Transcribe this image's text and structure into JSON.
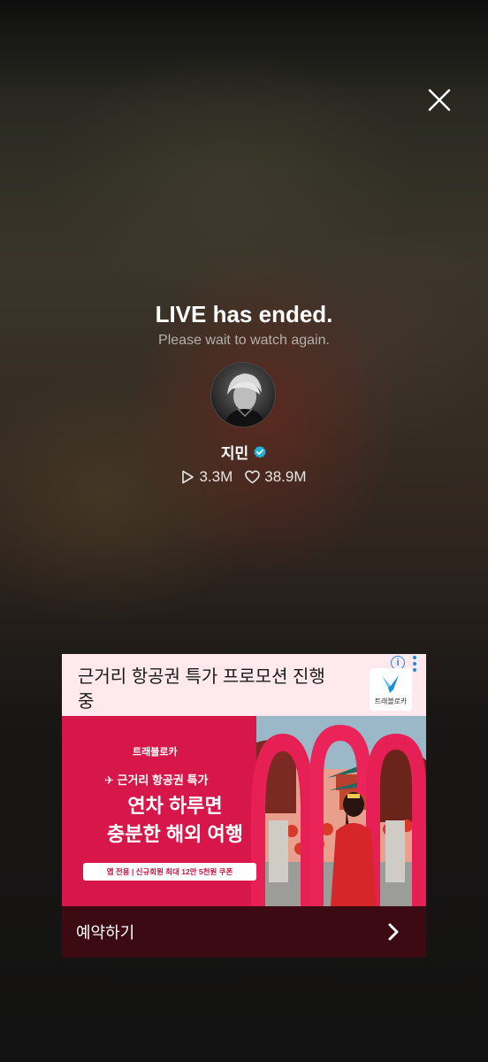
{
  "live": {
    "title": "LIVE has ended.",
    "subtitle": "Please wait to watch again."
  },
  "creator": {
    "name": "지민",
    "verified": true,
    "plays": "3.3M",
    "likes": "38.9M"
  },
  "ad": {
    "headline": "근거리 항공권 특가 프로모션 진행 중",
    "logo_text": "트래블로카",
    "info_icon": "i",
    "banner": {
      "brand": "트래블로카",
      "tag": "✈ 근거리 항공권 특가",
      "big_line1": "연차 하루면",
      "big_line2": "충분한 해외 여행",
      "coupon": "앱 전용 | 신규회원 최대 12만 5천원 쿠폰"
    },
    "cta_label": "예약하기"
  },
  "colors": {
    "accent_verified": "#20b0d8",
    "ad_banner": "#d7164a",
    "ad_cta": "#3b0a12"
  }
}
